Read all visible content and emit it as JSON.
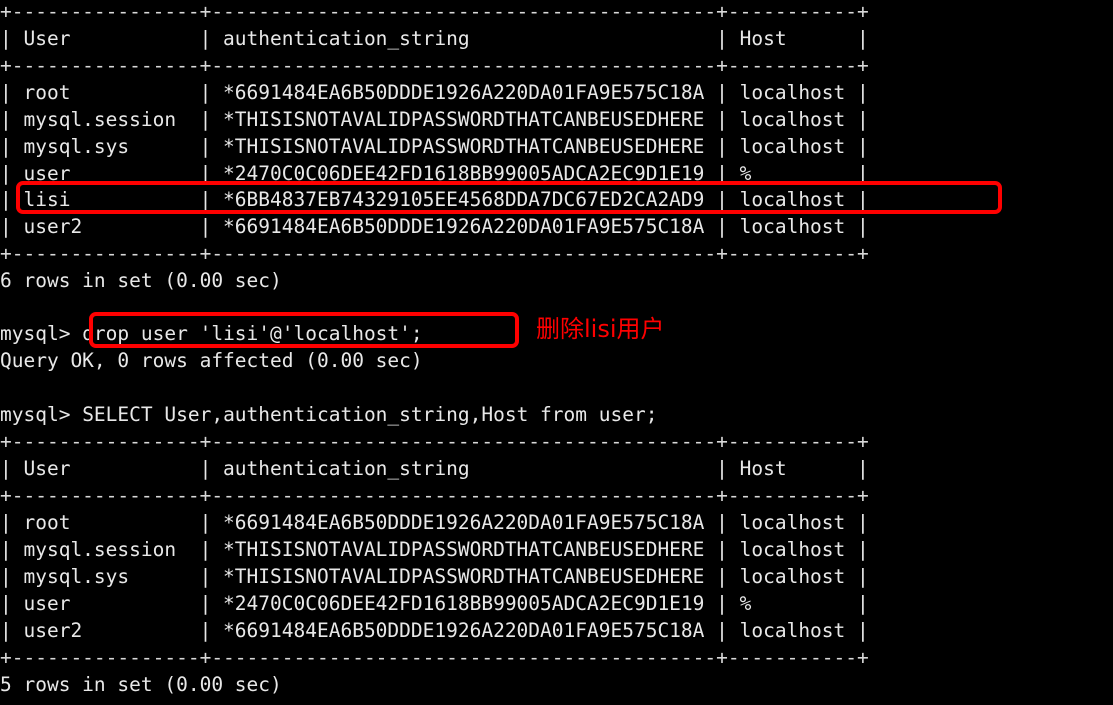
{
  "terminal": {
    "prompt": "mysql>",
    "background_color": "#000000",
    "text_color": "#e8e8e8",
    "highlight_color": "#ff0000"
  },
  "table_rule_top": "+----------------+-------------------------------------------+-----------+",
  "table_header": "| User           | authentication_string                     | Host      |",
  "table_rule_mid": "+----------------+-------------------------------------------+-----------+",
  "first_result": {
    "rows": [
      "| root           | *6691484EA6B50DDDE1926A220DA01FA9E575C18A | localhost |",
      "| mysql.session  | *THISISNOTAVALIDPASSWORDTHATCANBEUSEDHERE | localhost |",
      "| mysql.sys      | *THISISNOTAVALIDPASSWORDTHATCANBEUSEDHERE | localhost |",
      "| user           | *2470C0C06DEE42FD1618BB99005ADCA2EC9D1E19 | %         |",
      "| lisi           | *6BB4837EB74329105EE4568DDA7DC67ED2CA2AD9 | localhost |",
      "| user2          | *6691484EA6B50DDDE1926A220DA01FA9E575C18A | localhost |"
    ],
    "rule_bottom": "+----------------+-------------------------------------------+-----------+",
    "row_count_text": "6 rows in set (0.00 sec)"
  },
  "drop_command": {
    "prompt": "mysql> ",
    "command": "drop user 'lisi'@'localhost';",
    "annotation": "删除lisi用户",
    "result": "Query OK, 0 rows affected (0.00 sec)"
  },
  "select_command": {
    "prompt": "mysql> ",
    "command": "SELECT User,authentication_string,Host from user;"
  },
  "second_result": {
    "rule_top": "+----------------+-------------------------------------------+-----------+",
    "header": "| User           | authentication_string                     | Host      |",
    "rule_mid": "+----------------+-------------------------------------------+-----------+",
    "rows": [
      "| root           | *6691484EA6B50DDDE1926A220DA01FA9E575C18A | localhost |",
      "| mysql.session  | *THISISNOTAVALIDPASSWORDTHATCANBEUSEDHERE | localhost |",
      "| mysql.sys      | *THISISNOTAVALIDPASSWORDTHATCANBEUSEDHERE | localhost |",
      "| user           | *2470C0C06DEE42FD1618BB99005ADCA2EC9D1E19 | %         |",
      "| user2          | *6691484EA6B50DDDE1926A220DA01FA9E575C18A | localhost |"
    ],
    "rule_bottom": "+----------------+-------------------------------------------+-----------+",
    "row_count_text": "5 rows in set (0.00 sec)"
  }
}
